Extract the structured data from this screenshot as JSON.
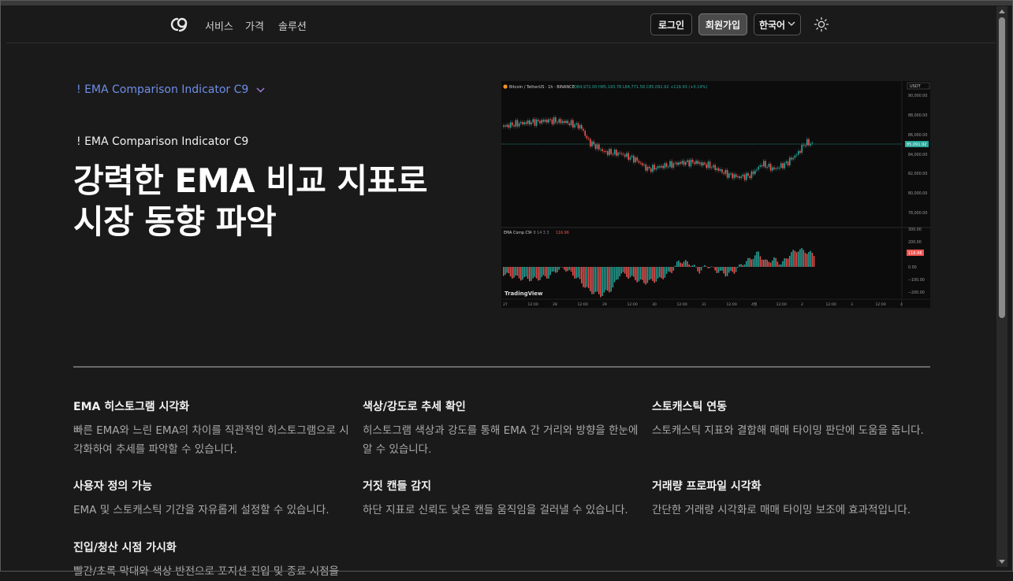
{
  "header": {
    "nav": [
      "서비스",
      "가격",
      "솔루션"
    ],
    "login": "로그인",
    "signup": "회원가입",
    "language": "한국어",
    "logo_icon": "c9-logo",
    "theme_icon": "sun-icon"
  },
  "hero": {
    "breadcrumb": "! EMA Comparison Indicator C9",
    "subtitle": "! EMA Comparison Indicator C9",
    "title": "강력한 EMA 비교 지표로 시장 동향 파악"
  },
  "chart": {
    "header_symbol": "Bitcoin / TetherUS · 1h · BINANCE",
    "header_values": "O84,972.00 H85,193.78 L84,771.58 C85,091.92 +119.93 (+0.14%)",
    "currency": "USDT",
    "last_price": "85,091.92",
    "price_ticks": [
      "90,000.00",
      "88,000.00",
      "86,000.00",
      "84,000.00",
      "82,000.00",
      "80,000.00",
      "78,000.00"
    ],
    "indicator_label": "EMA Comp C9",
    "indicator_nums": "4 8 14 3 3",
    "indicator_value": "116.96",
    "indicator_ticks": [
      "300.00",
      "200.00",
      "0.00",
      "−100.00",
      "−200.00"
    ],
    "watermark": "TradingView",
    "time_ticks": [
      "27",
      "12:00",
      "28",
      "12:00",
      "29",
      "12:00",
      "30",
      "12:00",
      "31",
      "12:00",
      "4월",
      "12:00",
      "2",
      "12:00",
      "3",
      "12:00",
      "4"
    ],
    "colors": {
      "up": "#26a69a",
      "down": "#ef5350",
      "price_line": "#26a69a"
    }
  },
  "features": [
    {
      "title": "EMA 히스토그램 시각화",
      "desc": "빠른 EMA와 느린 EMA의 차이를 직관적인 히스토그램으로 시각화하여 추세를 파악할 수 있습니다."
    },
    {
      "title": "색상/강도로 추세 확인",
      "desc": "히스토그램 색상과 강도를 통해 EMA 간 거리와 방향을 한눈에 알 수 있습니다."
    },
    {
      "title": "스토캐스틱 연동",
      "desc": "스토캐스틱 지표와 결합해 매매 타이밍 판단에 도움을 줍니다."
    },
    {
      "title": "사용자 정의 가능",
      "desc": "EMA 및 스토캐스틱 기간을 자유롭게 설정할 수 있습니다."
    },
    {
      "title": "거짓 캔들 감지",
      "desc": "하단 지표로 신뢰도 낮은 캔들 움직임을 걸러낼 수 있습니다."
    },
    {
      "title": "거래량 프로파일 시각화",
      "desc": "간단한 거래량 시각화로 매매 타이밍 보조에 효과적입니다."
    },
    {
      "title": "진입/청산 시점 가시화",
      "desc": "빨간/초록 막대와 색상 반전으로 포지션 진입 및 종료 시점을"
    }
  ]
}
